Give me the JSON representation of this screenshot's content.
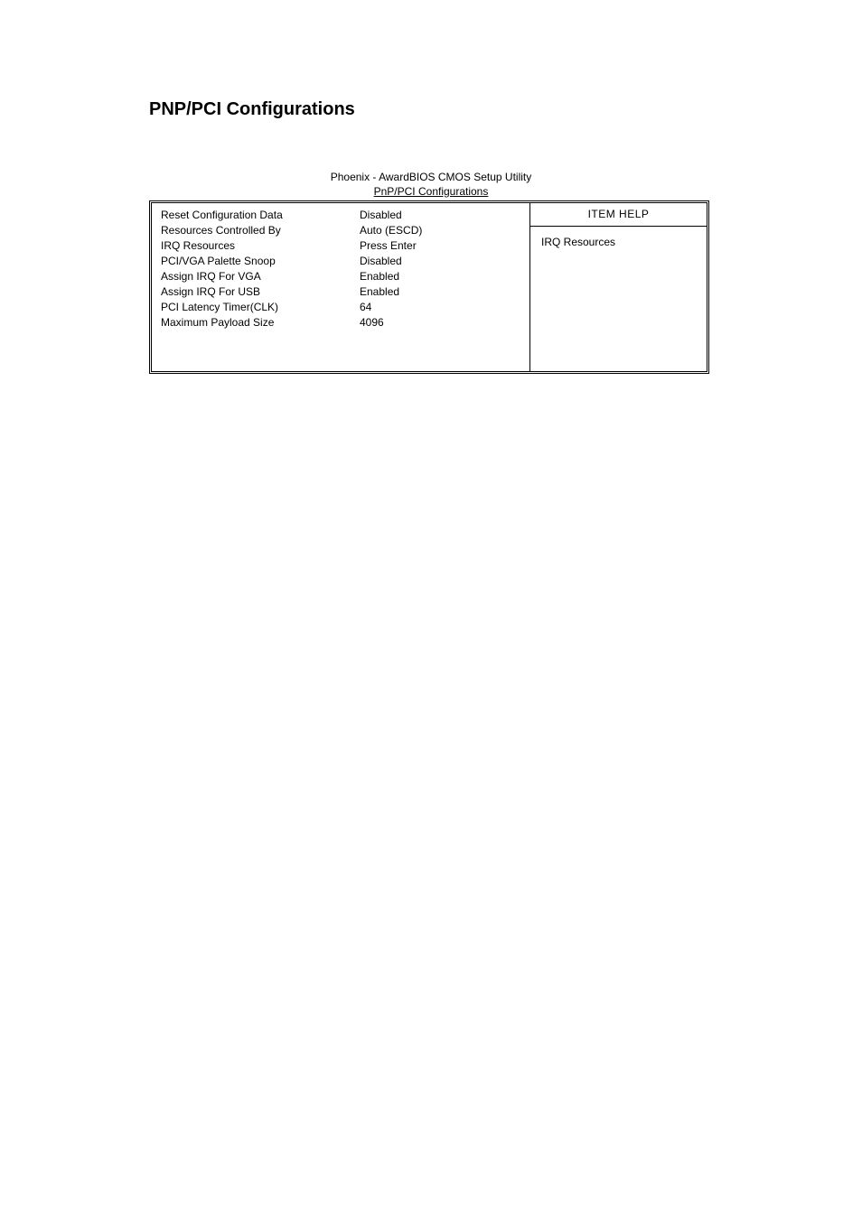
{
  "page": {
    "heading": "PNP/PCI Configurations"
  },
  "caption": {
    "line1": "Phoenix - AwardBIOS CMOS Setup Utility",
    "line2": "PnP/PCI Configurations"
  },
  "settings": [
    {
      "label": "Reset Configuration Data",
      "value": "Disabled"
    },
    {
      "label": "Resources Controlled By",
      "value": "Auto (ESCD)"
    },
    {
      "label": "IRQ Resources",
      "value": "Press Enter"
    },
    {
      "label": "PCI/VGA Palette Snoop",
      "value": "Disabled"
    },
    {
      "label": "Assign IRQ For VGA",
      "value": "Enabled"
    },
    {
      "label": "Assign IRQ For USB",
      "value": "Enabled"
    },
    {
      "label": "PCI Latency Timer(CLK)",
      "value": "64"
    },
    {
      "label": "Maximum Payload Size",
      "value": "4096"
    }
  ],
  "help": {
    "header": "ITEM HELP",
    "body": "IRQ Resources"
  }
}
